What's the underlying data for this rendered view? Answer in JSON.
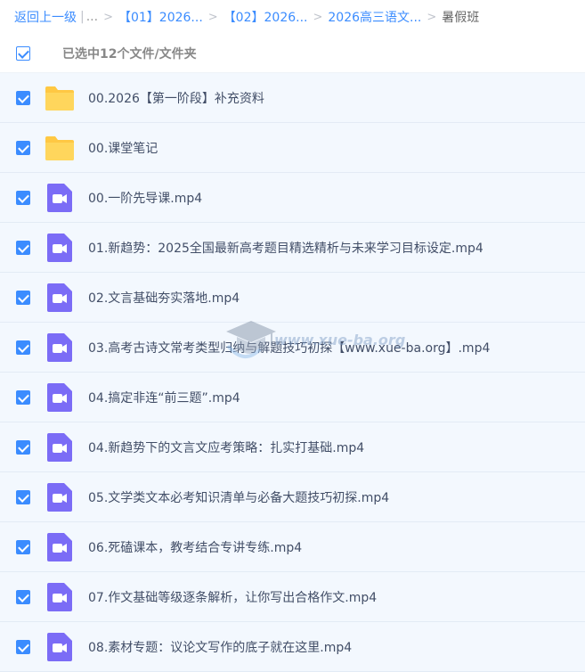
{
  "breadcrumb": {
    "back": "返回上一级",
    "ellipsis": "...",
    "crumbs": [
      "【01】2026...",
      "【02】2026...",
      "2026高三语文..."
    ],
    "current": "暑假班"
  },
  "selection": {
    "label": "已选中12个文件/文件夹",
    "checked": true
  },
  "files": [
    {
      "name": "00.2026【第一阶段】补充资料",
      "type": "folder",
      "checked": true
    },
    {
      "name": "00.课堂笔记",
      "type": "folder",
      "checked": true
    },
    {
      "name": "00.一阶先导课.mp4",
      "type": "video",
      "checked": true
    },
    {
      "name": "01.新趋势：2025全国最新高考题目精选精析与未来学习目标设定.mp4",
      "type": "video",
      "checked": true
    },
    {
      "name": "02.文言基础夯实落地.mp4",
      "type": "video",
      "checked": true
    },
    {
      "name": "03.高考古诗文常考类型归纳与解题技巧初探【www.xue-ba.org】.mp4",
      "type": "video",
      "checked": true
    },
    {
      "name": "04.搞定非连“前三题”.mp4",
      "type": "video",
      "checked": true
    },
    {
      "name": "04.新趋势下的文言文应考策略：扎实打基础.mp4",
      "type": "video",
      "checked": true
    },
    {
      "name": "05.文学类文本必考知识清单与必备大题技巧初探.mp4",
      "type": "video",
      "checked": true
    },
    {
      "name": "06.死磕课本，教考结合专讲专练.mp4",
      "type": "video",
      "checked": true
    },
    {
      "name": "07.作文基础等级逐条解析，让你写出合格作文.mp4",
      "type": "video",
      "checked": true
    },
    {
      "name": "08.素材专题：议论文写作的底子就在这里.mp4",
      "type": "video",
      "checked": true
    }
  ],
  "watermark": {
    "text": "www.xue-ba.org"
  },
  "colors": {
    "accent": "#3b8cff",
    "folder": "#ffd05c",
    "video": "#7b6cf6",
    "row_bg": "#f3f8fe"
  }
}
